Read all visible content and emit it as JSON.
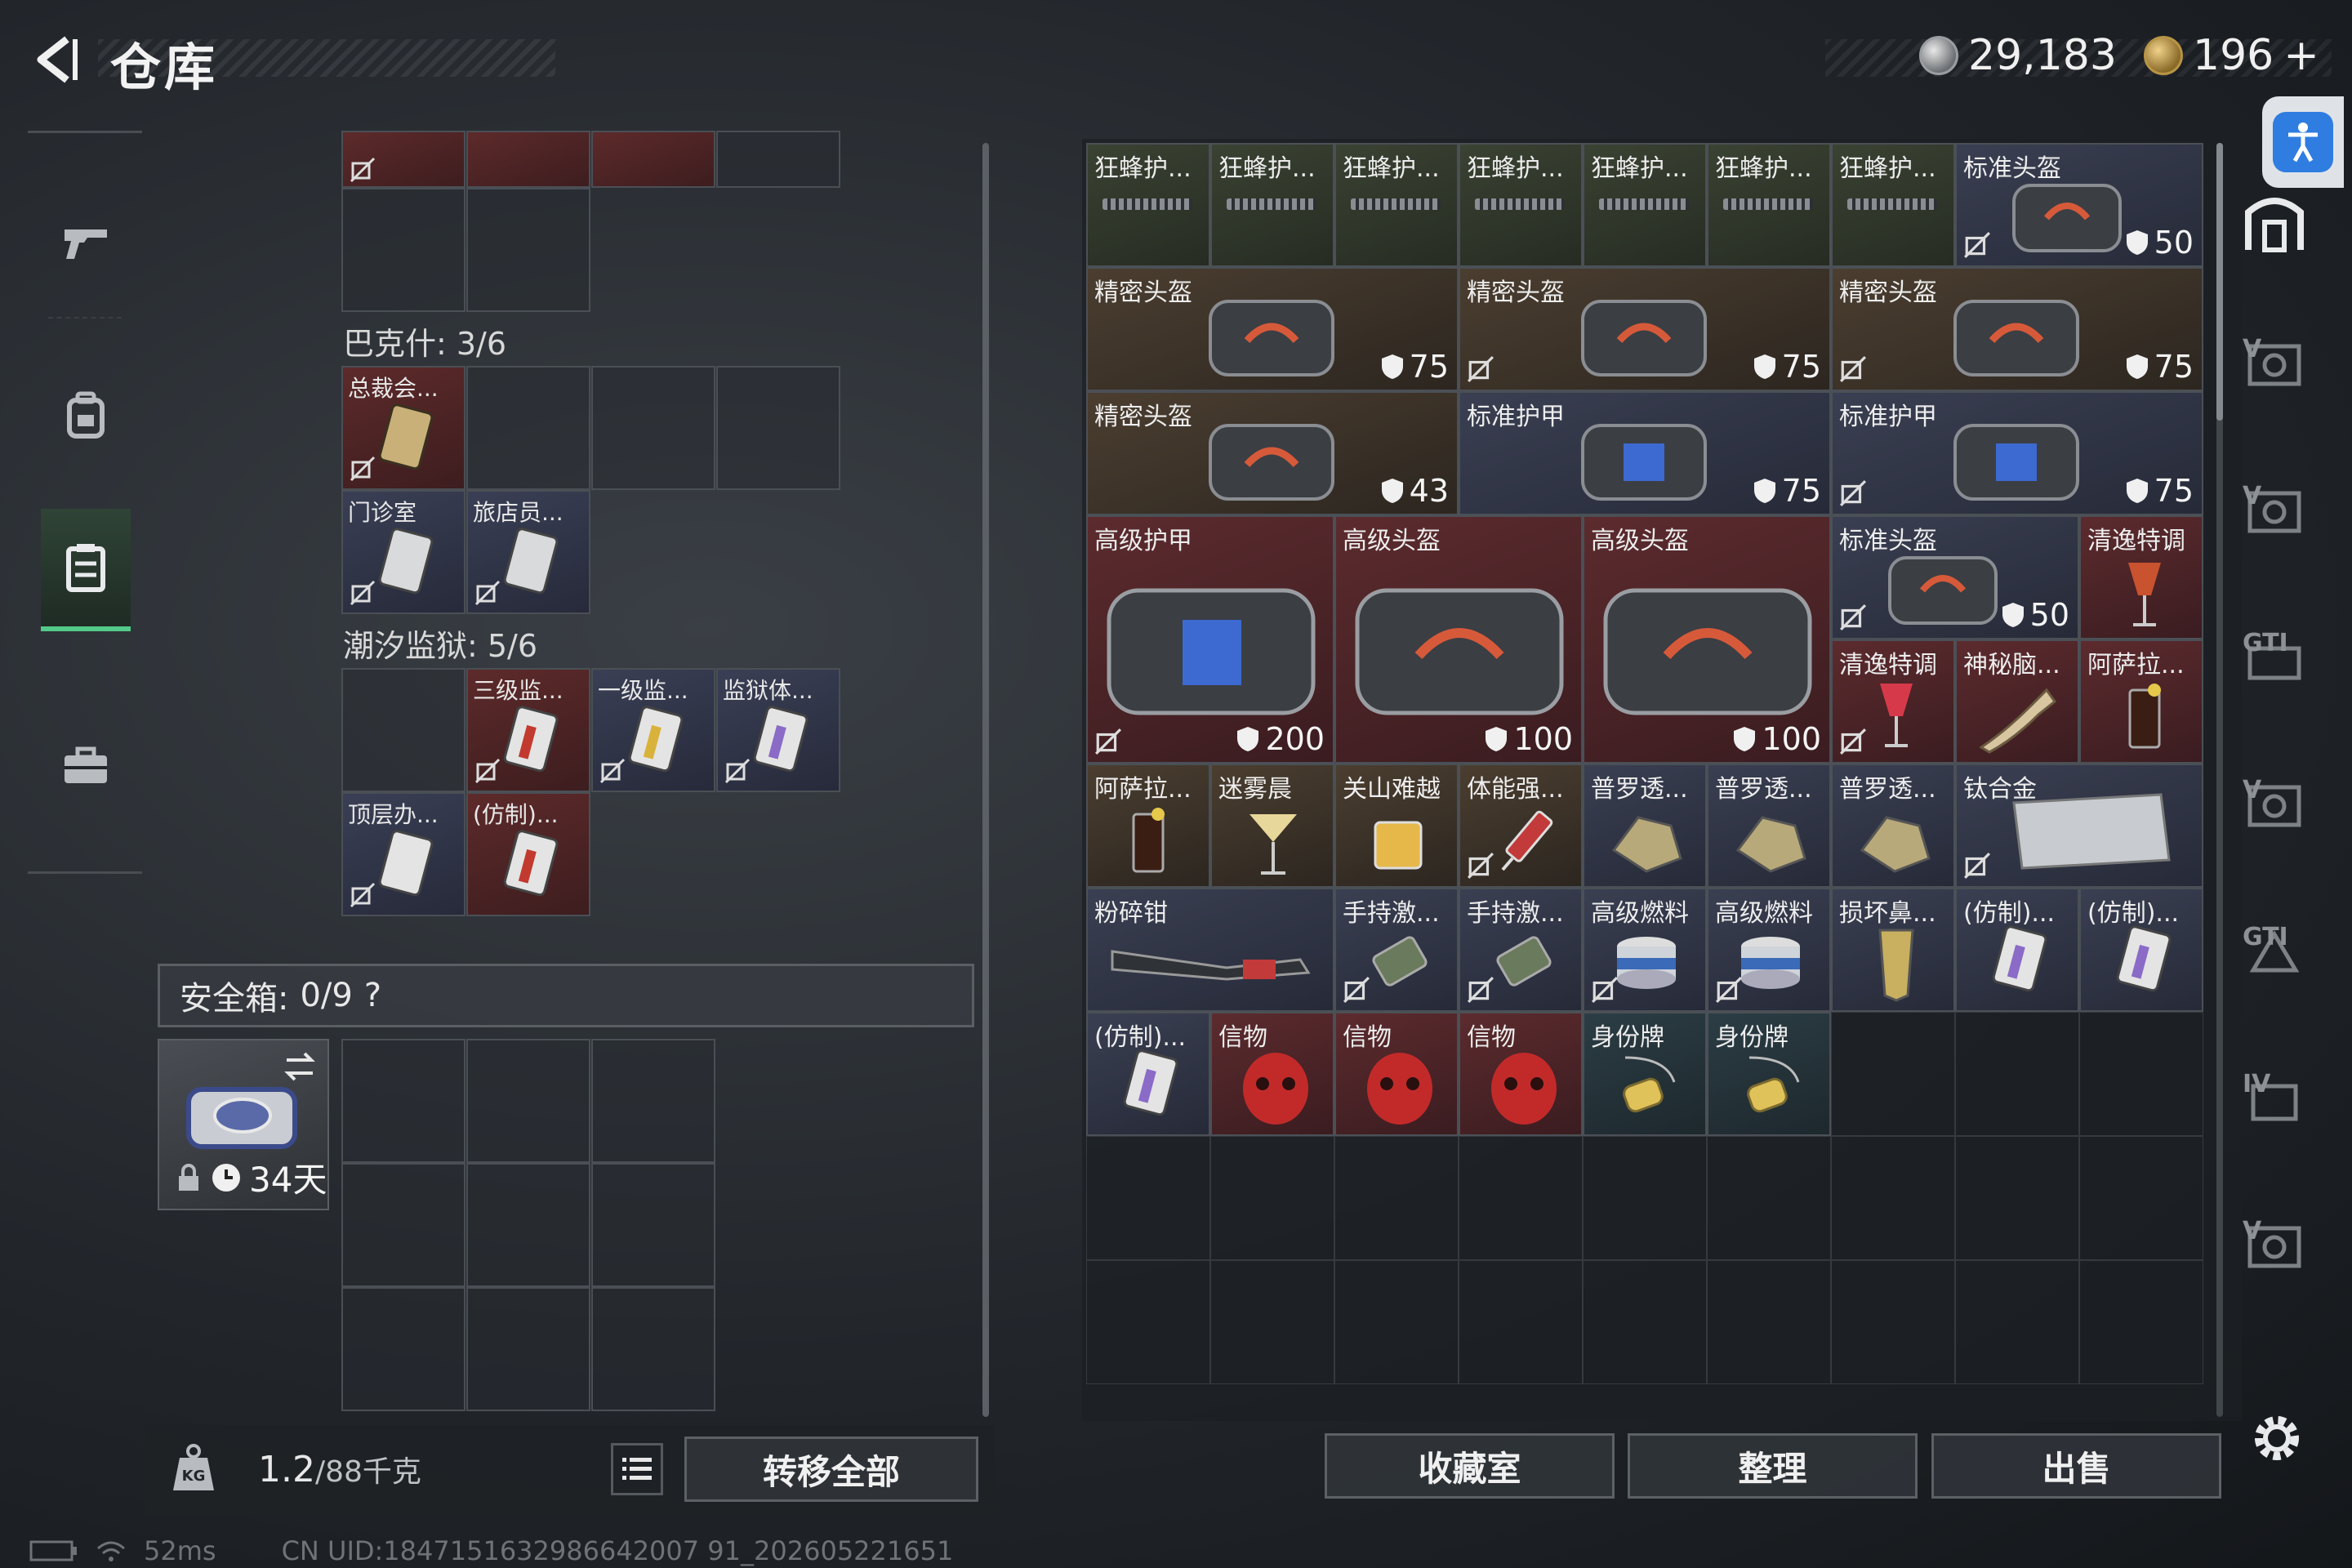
{
  "header": {
    "title": "仓库",
    "silver_amount": "29,183",
    "gold_amount": "196",
    "gold_plus": "+"
  },
  "left_nav": {
    "items": [
      "weapons",
      "backpack",
      "stash",
      "briefcase"
    ],
    "active": "stash"
  },
  "loadout": {
    "bakshi_label": "巴克什: 3/6",
    "tide_prison_label": "潮汐监狱: 5/6",
    "items": [
      {
        "label": "总裁会..."
      },
      {
        "label": "门诊室"
      },
      {
        "label": "旅店员..."
      },
      {
        "label": "三级监..."
      },
      {
        "label": "一级监..."
      },
      {
        "label": "监狱体..."
      },
      {
        "label": "顶层办..."
      },
      {
        "label": "(仿制)..."
      }
    ],
    "safebox": {
      "label": "安全箱: ",
      "value": "0/9",
      "help": "?",
      "days": "34天"
    }
  },
  "bottom_left": {
    "weight_current": "1.2",
    "weight_max": "/88千克",
    "transfer_all": "转移全部"
  },
  "stash": {
    "items": [
      {
        "label": "狂蜂护..."
      },
      {
        "label": "狂蜂护..."
      },
      {
        "label": "狂蜂护..."
      },
      {
        "label": "狂蜂护..."
      },
      {
        "label": "狂蜂护..."
      },
      {
        "label": "狂蜂护..."
      },
      {
        "label": "狂蜂护..."
      },
      {
        "label": "标准头盔",
        "value": "50"
      },
      {
        "label": "精密头盔",
        "value": "75"
      },
      {
        "label": "精密头盔",
        "value": "75"
      },
      {
        "label": "精密头盔",
        "value": "75"
      },
      {
        "label": "精密头盔",
        "value": "43"
      },
      {
        "label": "标准护甲",
        "value": "75"
      },
      {
        "label": "标准护甲",
        "value": "75"
      },
      {
        "label": "高级护甲",
        "value": "200"
      },
      {
        "label": "高级头盔",
        "value": "100"
      },
      {
        "label": "高级头盔",
        "value": "100"
      },
      {
        "label": "标准头盔",
        "value": "50"
      },
      {
        "label": "清逸特调"
      },
      {
        "label": "清逸特调"
      },
      {
        "label": "神秘脑..."
      },
      {
        "label": "阿萨拉..."
      },
      {
        "label": "阿萨拉..."
      },
      {
        "label": "迷雾晨"
      },
      {
        "label": "关山难越"
      },
      {
        "label": "体能强..."
      },
      {
        "label": "普罗透..."
      },
      {
        "label": "普罗透..."
      },
      {
        "label": "普罗透..."
      },
      {
        "label": "钛合金"
      },
      {
        "label": "粉碎钳"
      },
      {
        "label": "手持激..."
      },
      {
        "label": "手持激..."
      },
      {
        "label": "高级燃料"
      },
      {
        "label": "高级燃料"
      },
      {
        "label": "损坏鼻..."
      },
      {
        "label": "(仿制)..."
      },
      {
        "label": "(仿制)..."
      },
      {
        "label": "(仿制)..."
      },
      {
        "label": "信物"
      },
      {
        "label": "信物"
      },
      {
        "label": "信物"
      },
      {
        "label": "身份牌"
      },
      {
        "label": "身份牌"
      }
    ]
  },
  "actions": {
    "collection": "收藏室",
    "sort": "整理",
    "sell": "出售"
  },
  "status_bar": {
    "ping": "52ms",
    "uid": "CN UID:1847151632986642007 91_202605221651"
  },
  "colors": {
    "accent_green": "#53c98a",
    "accessibility_blue": "#2f7de0"
  }
}
